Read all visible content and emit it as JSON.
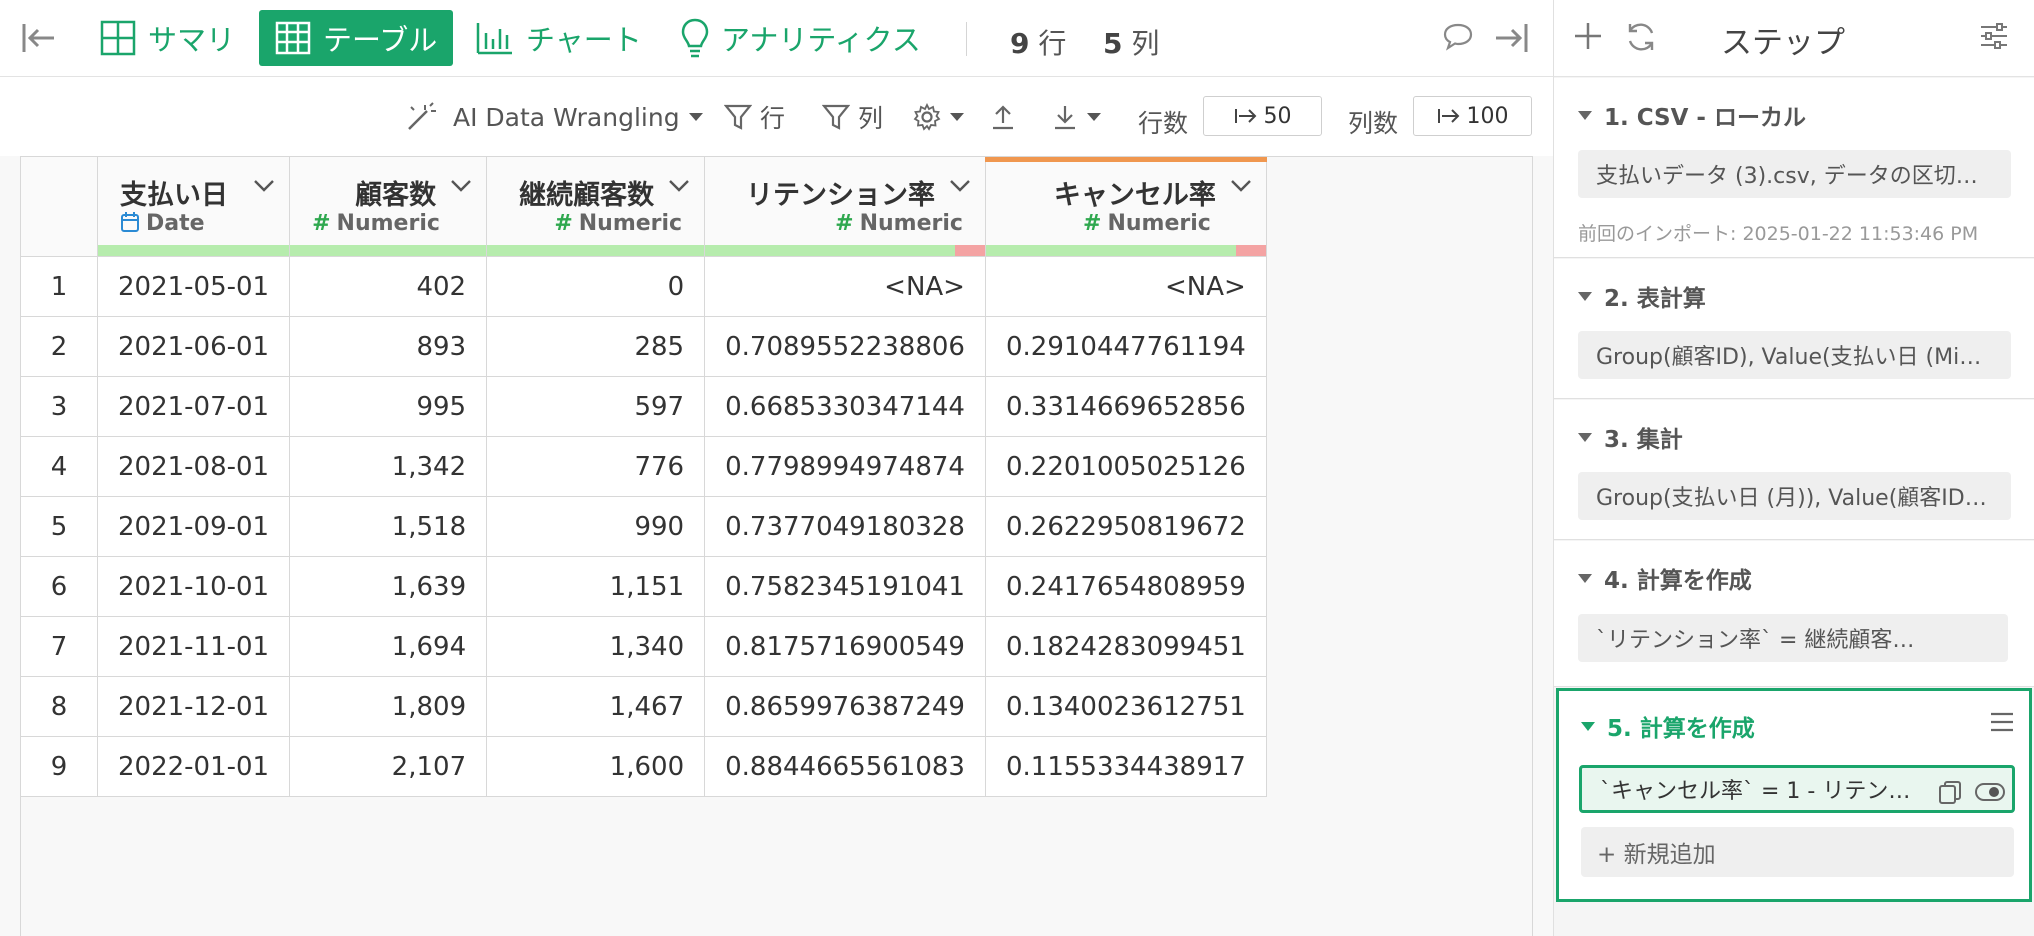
{
  "topbar": {
    "tabs": [
      {
        "label": "サマリ"
      },
      {
        "label": "テーブル"
      },
      {
        "label": "チャート"
      },
      {
        "label": "アナリティクス"
      }
    ],
    "row_count": "9",
    "row_unit": "行",
    "col_count": "5",
    "col_unit": "列"
  },
  "toolbar": {
    "ai_label": "AI Data Wrangling",
    "filter_row_label": "行",
    "filter_col_label": "列",
    "rows_label": "行数",
    "rows_value": "50",
    "cols_label": "列数",
    "cols_value": "100"
  },
  "grid": {
    "columns": [
      {
        "name": "支払い日",
        "type": "Date"
      },
      {
        "name": "顧客数",
        "type": "Numeric"
      },
      {
        "name": "継続顧客数",
        "type": "Numeric"
      },
      {
        "name": "リテンション率",
        "type": "Numeric"
      },
      {
        "name": "キャンセル率",
        "type": "Numeric"
      }
    ],
    "rows": [
      {
        "n": "1",
        "date": "2021-05-01",
        "customers": "402",
        "retained": "0",
        "retention": "<NA>",
        "cancel": "<NA>"
      },
      {
        "n": "2",
        "date": "2021-06-01",
        "customers": "893",
        "retained": "285",
        "retention": "0.7089552238806",
        "cancel": "0.2910447761194"
      },
      {
        "n": "3",
        "date": "2021-07-01",
        "customers": "995",
        "retained": "597",
        "retention": "0.6685330347144",
        "cancel": "0.3314669652856"
      },
      {
        "n": "4",
        "date": "2021-08-01",
        "customers": "1,342",
        "retained": "776",
        "retention": "0.7798994974874",
        "cancel": "0.2201005025126"
      },
      {
        "n": "5",
        "date": "2021-09-01",
        "customers": "1,518",
        "retained": "990",
        "retention": "0.7377049180328",
        "cancel": "0.2622950819672"
      },
      {
        "n": "6",
        "date": "2021-10-01",
        "customers": "1,639",
        "retained": "1,151",
        "retention": "0.7582345191041",
        "cancel": "0.2417654808959"
      },
      {
        "n": "7",
        "date": "2021-11-01",
        "customers": "1,694",
        "retained": "1,340",
        "retention": "0.8175716900549",
        "cancel": "0.1824283099451"
      },
      {
        "n": "8",
        "date": "2021-12-01",
        "customers": "1,809",
        "retained": "1,467",
        "retention": "0.8659976387249",
        "cancel": "0.1340023612751"
      },
      {
        "n": "9",
        "date": "2022-01-01",
        "customers": "2,107",
        "retained": "1,600",
        "retention": "0.8844665561083",
        "cancel": "0.1155334438917"
      }
    ]
  },
  "side": {
    "title": "ステップ",
    "steps": [
      {
        "title": "1. CSV - ローカル",
        "summary": "支払いデータ (3).csv, データの区切…",
        "note": "前回のインポート: 2025-01-22 11:53:46 PM"
      },
      {
        "title": "2. 表計算",
        "summary": "Group(顧客ID), Value(支払い日 (Min…"
      },
      {
        "title": "3. 集計",
        "summary": "Group(支払い日 (月)), Value(顧客ID,…"
      },
      {
        "title": "4. 計算を作成",
        "summary": "`リテンション率` = 継続顧客…"
      },
      {
        "title": "5. 計算を作成",
        "summary": "`キャンセル率` = 1 - リテン…"
      }
    ],
    "add_label": "+ 新規追加"
  },
  "colors": {
    "accent": "#1aa56b",
    "quality_ok": "#b6ecad",
    "quality_bad": "#f4a3a3",
    "selected_col": "#f0974f"
  }
}
